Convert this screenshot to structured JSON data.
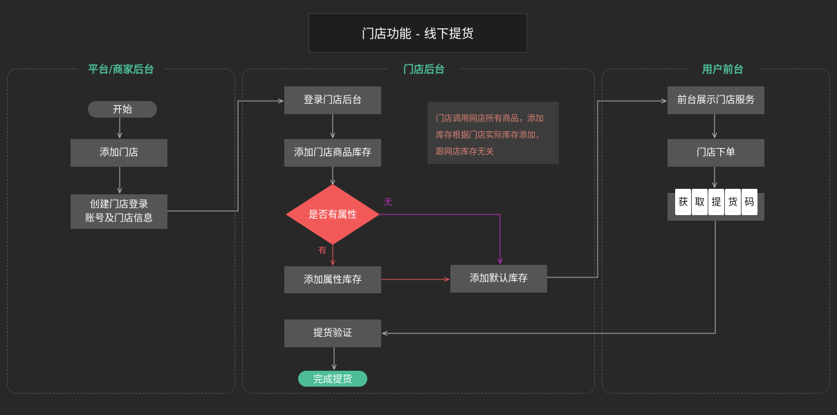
{
  "title": "门店功能 - 线下提货",
  "lanes": {
    "platform": {
      "title": "平台/商家后台"
    },
    "store": {
      "title": "门店后台"
    },
    "user": {
      "title": "用户前台"
    }
  },
  "nodes": {
    "start": "开始",
    "add_store": "添加门店",
    "create_account_line1": "创建门店登录",
    "create_account_line2": "账号及门店信息",
    "login_store": "登录门店后台",
    "add_goods_stock": "添加门店商品库存",
    "has_attribute": "是否有属性",
    "add_attr_stock": "添加属性库存",
    "add_default_stock": "添加默认库存",
    "pickup_verify": "提货验证",
    "finish_pickup": "完成提货",
    "front_show": "前台展示门店服务",
    "place_order": "门店下单"
  },
  "pickup_code_chars": [
    "获",
    "取",
    "提",
    "货",
    "码"
  ],
  "edge_labels": {
    "no": "无",
    "yes": "有"
  },
  "note": {
    "line1": "门店调用网店所有商品，添加",
    "line2": "库存根据门店实际库存添加，",
    "line3": "跟网店库存无关"
  },
  "colors": {
    "background": "#282828",
    "node": "#555556",
    "accent_green": "#4dbd98",
    "decision_red": "#f25a5a",
    "no_branch_magenta": "#c130c1",
    "note_text": "#d67f70"
  }
}
